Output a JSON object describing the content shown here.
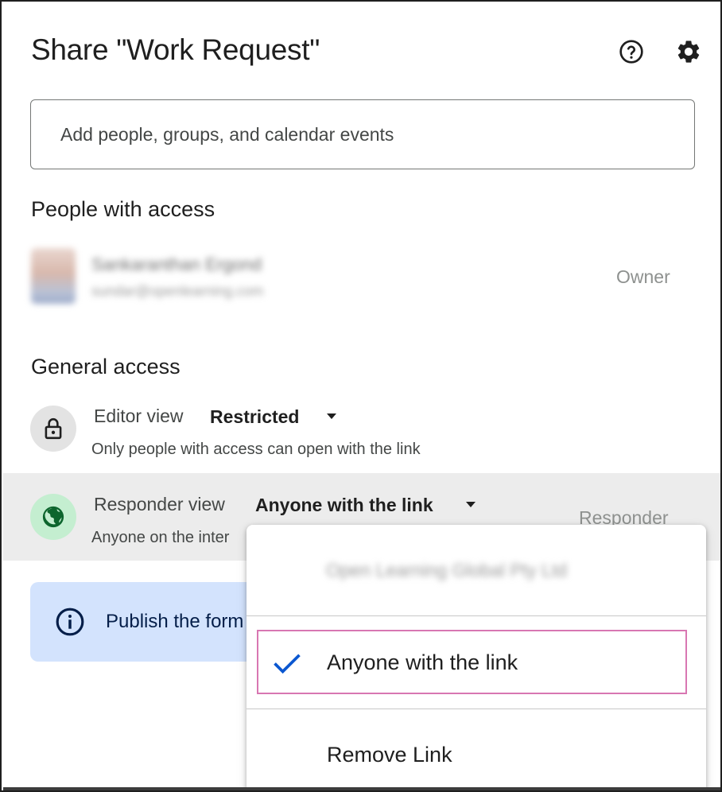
{
  "dialog": {
    "title": "Share \"Work Request\"",
    "help_icon": "help-circle-icon",
    "settings_icon": "gear-icon"
  },
  "add_people": {
    "placeholder": "Add people, groups, and calendar events"
  },
  "people_with_access": {
    "heading": "People with access",
    "owner": {
      "name": "Sankaranthan Ergond",
      "email": "sundar@openlearning.com",
      "role": "Owner"
    }
  },
  "general_access": {
    "heading": "General access",
    "editor": {
      "label": "Editor view",
      "value": "Restricted",
      "description": "Only people with access can open with the link",
      "icon": "lock-icon"
    },
    "responder": {
      "label": "Responder view",
      "value": "Anyone with the link",
      "description": "Anyone on the inter",
      "role": "Responder",
      "icon": "globe-icon"
    }
  },
  "publish_banner": {
    "text": "Publish the form",
    "icon": "info-icon"
  },
  "dropdown_menu": {
    "org_option": "Open Learning Global Pty Ltd",
    "selected_option": "Anyone with the link",
    "remove_option": "Remove Link",
    "check_icon": "check-icon"
  },
  "colors": {
    "accent": "#0b57d0",
    "highlight_border": "#d877b2",
    "banner_bg": "#d3e3fd",
    "globe_bg": "#c4eed0"
  }
}
